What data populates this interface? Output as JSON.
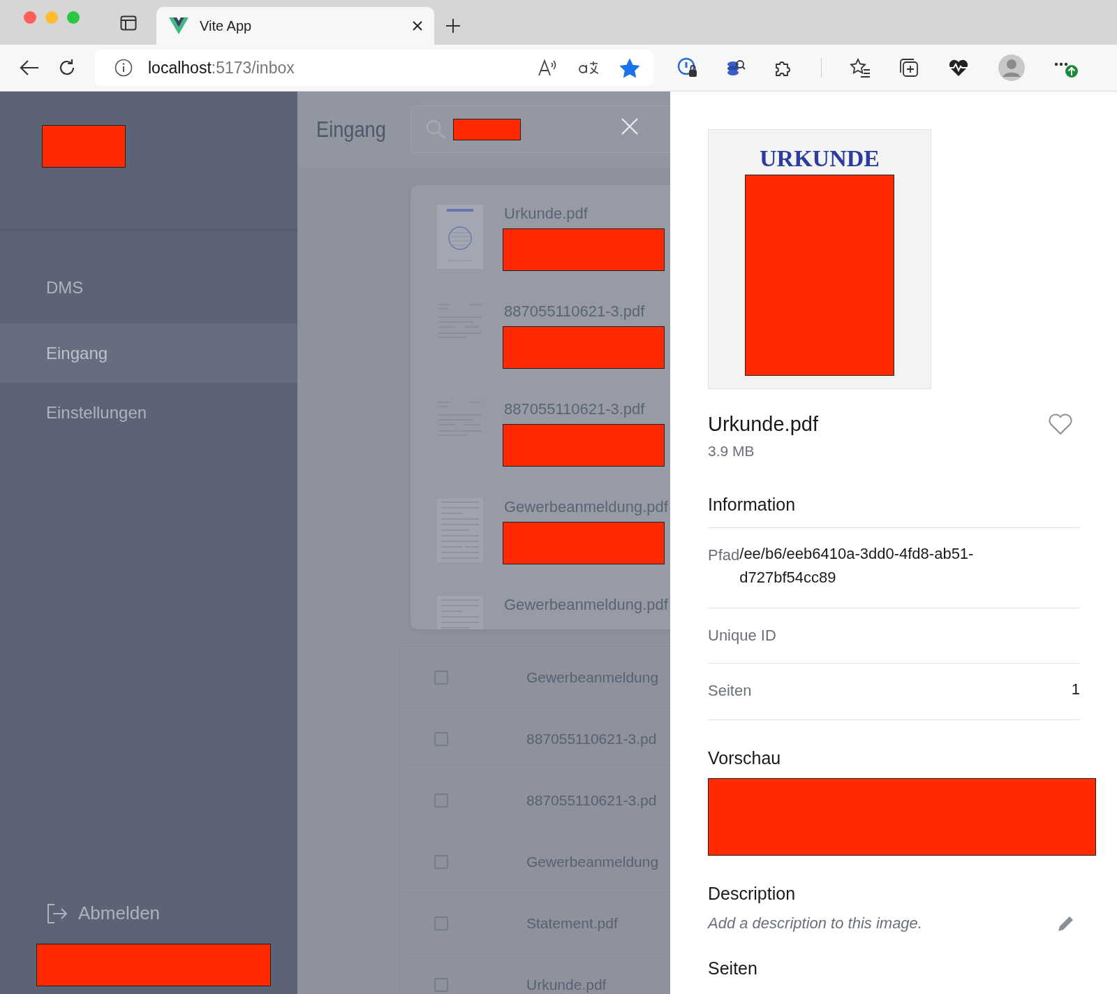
{
  "browser": {
    "tab_title": "Vite App",
    "url_host": "localhost",
    "url_path": ":5173/inbox",
    "bookmarked": true
  },
  "sidebar": {
    "logo": {
      "redacted": true
    },
    "items": [
      {
        "label": "DMS",
        "selected": false
      },
      {
        "label": "Eingang",
        "selected": true
      },
      {
        "label": "Einstellungen",
        "selected": false
      }
    ],
    "logout": "Abmelden",
    "user": {
      "redacted": true
    }
  },
  "inbox": {
    "title": "Eingang",
    "search": {
      "redacted": true
    },
    "results": [
      {
        "name": "Urkunde.pdf",
        "kind": "certificate",
        "redacted": true
      },
      {
        "name": "887055110621-3.pdf",
        "kind": "letter",
        "redacted": true
      },
      {
        "name": "887055110621-3.pdf",
        "kind": "letter",
        "redacted": true
      },
      {
        "name": "Gewerbeanmeldung.pdf",
        "kind": "form",
        "redacted": true
      },
      {
        "name": "Gewerbeanmeldung.pdf",
        "kind": "form"
      }
    ],
    "rows": [
      {
        "name": "Gewerbeanmeldung",
        "checked": false
      },
      {
        "name": "887055110621-3.pd",
        "checked": false
      },
      {
        "name": "887055110621-3.pd",
        "checked": false
      },
      {
        "name": "Gewerbeanmeldung",
        "checked": false
      },
      {
        "name": "Statement.pdf",
        "checked": false
      },
      {
        "name": "Urkunde.pdf",
        "checked": false
      }
    ]
  },
  "details": {
    "preview_heading": "URKUNDE",
    "preview_redacted": true,
    "file_name": "Urkunde.pdf",
    "size": "3.9 MB",
    "favorite": false,
    "information_title": "Information",
    "info": [
      {
        "label": "Pfad",
        "value": "/ee/b6/eeb6410a-3dd0-4fd8-ab51-d727bf54cc89",
        "kind": "inline"
      },
      {
        "label": "Unique ID",
        "kind": "split"
      },
      {
        "label": "Seiten",
        "value": "1",
        "kind": "split"
      }
    ],
    "vorschau_title": "Vorschau",
    "vorschau_redacted": true,
    "description_title": "Description",
    "description_placeholder": "Add a description to this image.",
    "seiten_title": "Seiten"
  }
}
